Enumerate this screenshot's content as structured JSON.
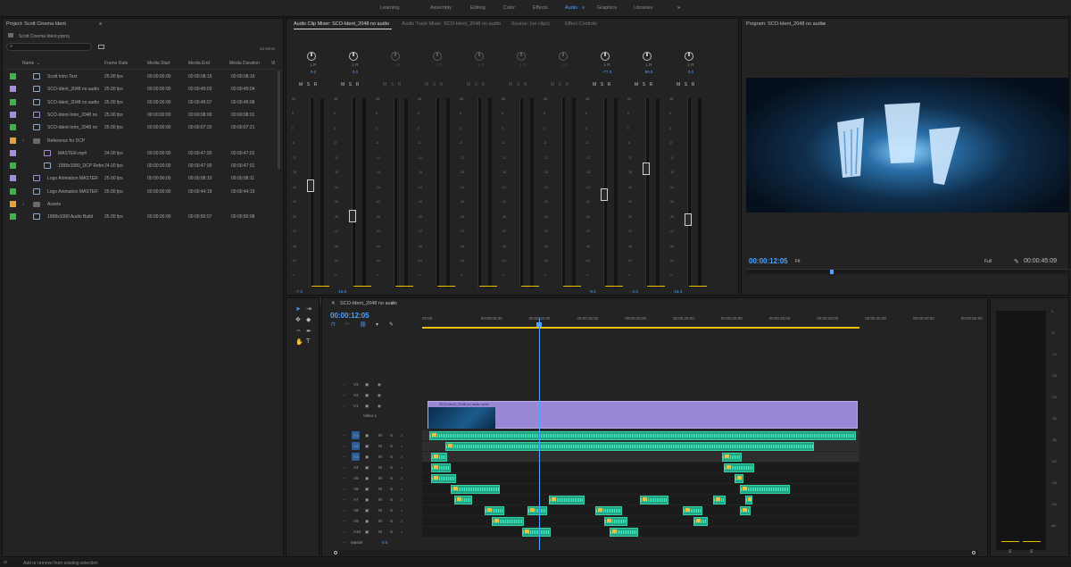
{
  "workspaces": {
    "items": [
      "Learning",
      "Assembly",
      "Editing",
      "Color",
      "Effects",
      "Audio",
      "Graphics",
      "Libraries"
    ],
    "overflow": "»"
  },
  "project": {
    "title": "Project: Scott Cinema Ident",
    "file": "Scott Cinema Ident.prproj",
    "count": "12 Items",
    "search_placeholder": "",
    "columns": [
      "Name",
      "Frame Rate",
      "Media Start",
      "Media End",
      "Media Duration",
      "Vi"
    ],
    "rows": [
      {
        "name": "Scott Intro Text",
        "color": "#3bb54a",
        "type": "seq",
        "fr": "25.00 fps",
        "start": "00:00:00:00",
        "end": "00:00:08:15",
        "dur": "00:00:08:16"
      },
      {
        "name": "SCO-Ident_2048 no audio",
        "color": "#a78be0",
        "type": "seq",
        "fr": "25.00 fps",
        "start": "00:00:00:00",
        "end": "00:00:45:03",
        "dur": "00:00:45:04"
      },
      {
        "name": "SCO-Ident_2048 no audio",
        "color": "#3bb54a",
        "type": "seq",
        "fr": "25.00 fps",
        "start": "00:00:00:00",
        "end": "00:00:45:07",
        "dur": "00:00:45:08"
      },
      {
        "name": "SCO-Ident-Intro_2048 no",
        "color": "#a78be0",
        "type": "clip",
        "fr": "25.00 fps",
        "start": "00:00:00:00",
        "end": "00:00:08:00",
        "dur": "00:00:08:01"
      },
      {
        "name": "SCO-Ident-Intro_2048 no",
        "color": "#3bb54a",
        "type": "seq",
        "fr": "25.00 fps",
        "start": "00:00:00:00",
        "end": "00:00:07:20",
        "dur": "00:00:07:21"
      },
      {
        "name": "Reference for DCP",
        "color": "#e8a23a",
        "type": "folder",
        "fr": "",
        "start": "",
        "end": "",
        "dur": ""
      },
      {
        "name": "MASTER.mp4",
        "color": "#a78be0",
        "type": "clip",
        "fr": "24.00 fps",
        "start": "00:00:00:00",
        "end": "00:00:47:00",
        "dur": "00:00:47:01",
        "indent": true
      },
      {
        "name": "1998x1080_DCP Refer",
        "color": "#3bb54a",
        "type": "seq",
        "fr": "24.00 fps",
        "start": "00:00:00:00",
        "end": "00:00:47:00",
        "dur": "00:00:47:01",
        "indent": true
      },
      {
        "name": "Logo Animation MASTER",
        "color": "#a78be0",
        "type": "clip",
        "fr": "25.00 fps",
        "start": "00:00:00:00",
        "end": "00:00:08:10",
        "dur": "00:00:08:11"
      },
      {
        "name": "Logo Animation MASTER",
        "color": "#3bb54a",
        "type": "seq",
        "fr": "25.00 fps",
        "start": "00:00:00:00",
        "end": "00:00:44:18",
        "dur": "00:00:44:19"
      },
      {
        "name": "Assets",
        "color": "#e8a23a",
        "type": "folder",
        "fr": "",
        "start": "",
        "end": "",
        "dur": ""
      },
      {
        "name": "1998x1080 Audio Build",
        "color": "#3bb54a",
        "type": "seq",
        "fr": "25.00 fps",
        "start": "00:00:00:00",
        "end": "00:00:50:07",
        "dur": "00:00:50:08"
      }
    ]
  },
  "mixer": {
    "tabs": [
      "Audio Clip Mixer: SCO-Ident_2048 no audio",
      "Audio Track Mixer: SCO-Ident_2048 no audio",
      "Source: (no clips)",
      "Effect Controls"
    ],
    "channels": [
      {
        "a": "A1",
        "name": "Audio 1",
        "val": "-7.3",
        "lrv": "0.0",
        "level": 0.7
      },
      {
        "a": "A2",
        "name": "Audio 2",
        "val": "-15.0",
        "lrv": "0.0",
        "level": 0.88
      },
      {
        "a": "A3",
        "name": "Audio 3",
        "val": "",
        "lrv": "",
        "level": null
      },
      {
        "a": "A4",
        "name": "Audio 4",
        "val": "",
        "lrv": "",
        "level": null
      },
      {
        "a": "A5",
        "name": "Audio 5",
        "val": "",
        "lrv": "",
        "level": null
      },
      {
        "a": "A6",
        "name": "Audio 6",
        "val": "",
        "lrv": "",
        "level": null
      },
      {
        "a": "A7",
        "name": "Audio 7",
        "val": "",
        "lrv": "",
        "level": null
      },
      {
        "a": "A8",
        "name": "Audio 8",
        "val": "-9.2",
        "lrv": "-77.3",
        "level": 0.75
      },
      {
        "a": "A9",
        "name": "Audio 9",
        "val": "-4.3",
        "lrv": "90.0",
        "level": 0.6
      },
      {
        "a": "A10",
        "name": "Audio 10",
        "val": "-16.4",
        "lrv": "0.0",
        "level": 0.9
      }
    ],
    "lr_label": "L  R",
    "msr": "M S R",
    "db": [
      "dB",
      "6",
      "0",
      "-6",
      "-12",
      "-18",
      "-24",
      "-30",
      "-36",
      "-42",
      "-48",
      "-54",
      "-∞"
    ]
  },
  "program": {
    "title": "Program: SCO-Ident_2048 no audio",
    "timecode": "00:00:12:05",
    "fit": "Fit",
    "full": "Full",
    "duration": "00:00:45:09"
  },
  "timeline": {
    "title": "SCO-Ident_2048 no audio",
    "timecode": "00:00:12:05",
    "ruler": [
      "00:00",
      "00:00:05:00",
      "00:00:10:00",
      "00:00:15:00",
      "00:00:20:00",
      "00:00:25:00",
      "00:00:30:00",
      "00:00:35:00",
      "00:00:40:00",
      "00:00:45:00",
      "00:00:50:00",
      "00:00:55:00"
    ],
    "video_tracks": [
      "V3",
      "V2",
      "V1"
    ],
    "video1_label": "Video 1",
    "audio_tracks": [
      "A1",
      "A2",
      "A3",
      "A4",
      "A5",
      "A6",
      "A7",
      "A8",
      "A9",
      "A10"
    ],
    "master": "Master",
    "master_val": "0.0",
    "clip_name": "SCO-Ident_2048 no audio.wmv"
  },
  "right_meter": {
    "labels": [
      "0",
      "-6",
      "-12",
      "-18",
      "-24",
      "-30",
      "-36",
      "-42",
      "-48",
      "-54",
      "dB"
    ],
    "bottom": [
      "S",
      "S"
    ]
  },
  "status": "Add or remove from existing selection",
  "colors": {
    "accent": "#4da3ff",
    "audio_clip": "#1fa382",
    "video_clip": "#9a88d6"
  }
}
